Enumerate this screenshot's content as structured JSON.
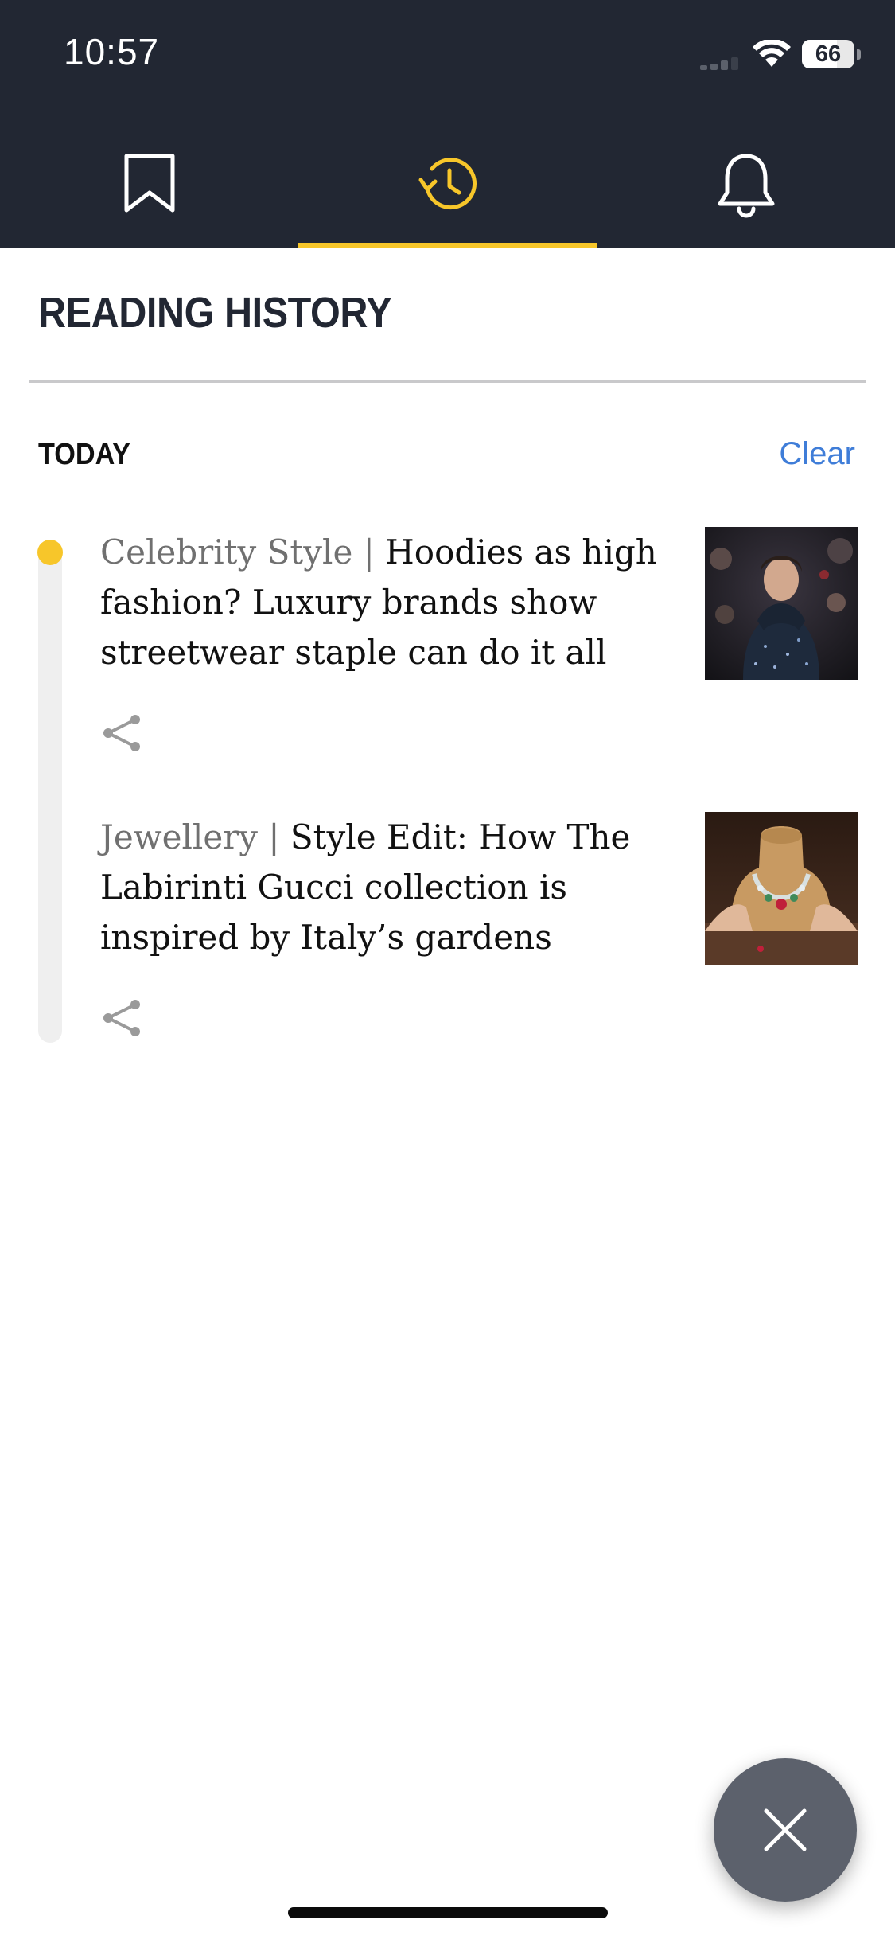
{
  "status_bar": {
    "time": "10:57",
    "battery": "66",
    "battery_percent": 66
  },
  "tabs": [
    {
      "id": "bookmarks",
      "icon": "bookmark-icon",
      "active": false
    },
    {
      "id": "history",
      "icon": "history-clock-icon",
      "active": true
    },
    {
      "id": "notifications",
      "icon": "bell-icon",
      "active": false
    }
  ],
  "page": {
    "title": "READING HISTORY"
  },
  "section": {
    "title": "TODAY",
    "clear_label": "Clear"
  },
  "articles": [
    {
      "category": "Celebrity Style",
      "separator": "|",
      "headline": "Hoodies as high fashion? Luxury brands show streetwear staple can do it all",
      "thumbnail_icon": "hoodie-photo",
      "share_icon": "share-icon"
    },
    {
      "category": "Jewellery",
      "separator": "|",
      "headline": "Style Edit: How The Labirinti Gucci collection is inspired by Italy’s gardens",
      "thumbnail_icon": "necklace-photo",
      "share_icon": "share-icon"
    }
  ],
  "colors": {
    "header_bg": "#222733",
    "accent": "#f7c62a",
    "link": "#3f7dd8",
    "category_text": "#707070",
    "fab_bg": "#5c616c"
  },
  "fab": {
    "icon": "close-icon"
  }
}
